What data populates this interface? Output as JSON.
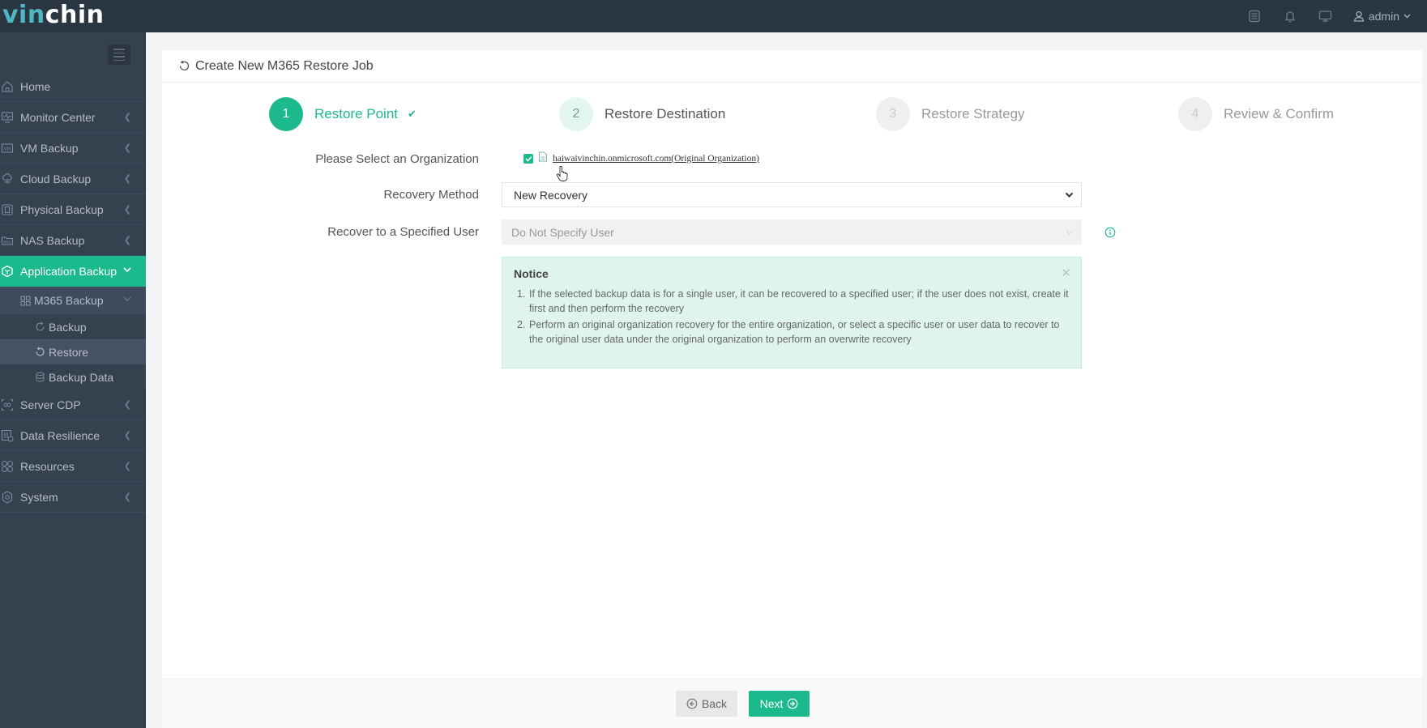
{
  "app": {
    "logo_part1": "vin",
    "logo_part2": "chin",
    "brand_color": "#1cb98d"
  },
  "topbar": {
    "icons": [
      "task-list-icon",
      "bell-icon",
      "monitor-icon"
    ],
    "user": "admin"
  },
  "sidebar": {
    "items": [
      {
        "label": "Home",
        "icon": "home-icon",
        "has_arrow": false
      },
      {
        "label": "Monitor Center",
        "icon": "monitor-icon",
        "has_arrow": true
      },
      {
        "label": "VM Backup",
        "icon": "vm-icon",
        "has_arrow": true
      },
      {
        "label": "Cloud Backup",
        "icon": "cloud-icon",
        "has_arrow": true
      },
      {
        "label": "Physical Backup",
        "icon": "server-icon",
        "has_arrow": true
      },
      {
        "label": "NAS Backup",
        "icon": "nas-icon",
        "has_arrow": true
      },
      {
        "label": "Application Backup",
        "icon": "cube-icon",
        "has_arrow": true,
        "active": true
      },
      {
        "label": "Server CDP",
        "icon": "cdp-icon",
        "has_arrow": true
      },
      {
        "label": "Data Resilience",
        "icon": "resilience-icon",
        "has_arrow": true
      },
      {
        "label": "Resources",
        "icon": "resources-icon",
        "has_arrow": true
      },
      {
        "label": "System",
        "icon": "gear-icon",
        "has_arrow": true
      }
    ],
    "submenu": {
      "label": "M365 Backup",
      "children": [
        {
          "label": "Backup",
          "icon": "refresh-icon"
        },
        {
          "label": "Restore",
          "icon": "restore-icon",
          "current": true
        },
        {
          "label": "Backup Data",
          "icon": "database-icon"
        }
      ]
    }
  },
  "page": {
    "title": "Create New M365 Restore Job",
    "steps": [
      {
        "num": "1",
        "label": "Restore Point",
        "state": "done"
      },
      {
        "num": "2",
        "label": "Restore Destination",
        "state": "current"
      },
      {
        "num": "3",
        "label": "Restore Strategy",
        "state": "todo"
      },
      {
        "num": "4",
        "label": "Review & Confirm",
        "state": "todo"
      }
    ],
    "form": {
      "org_label": "Please Select an Organization",
      "org_value": "haiwaivinchin.onmicrosoft.com(Original Organization)",
      "org_checked": true,
      "method_label": "Recovery Method",
      "method_value": "New Recovery",
      "user_label": "Recover to a Specified User",
      "user_value": "Do Not Specify User"
    },
    "notice": {
      "title": "Notice",
      "items": [
        "If the selected backup data is for a single user, it can be recovered to a specified user; if the user does not exist, create it first and then perform the recovery",
        "Perform an original organization recovery for the entire organization, or select a specific user or user data to recover to the original user data under the original organization to perform an overwrite recovery"
      ]
    },
    "buttons": {
      "back": "Back",
      "next": "Next"
    }
  }
}
